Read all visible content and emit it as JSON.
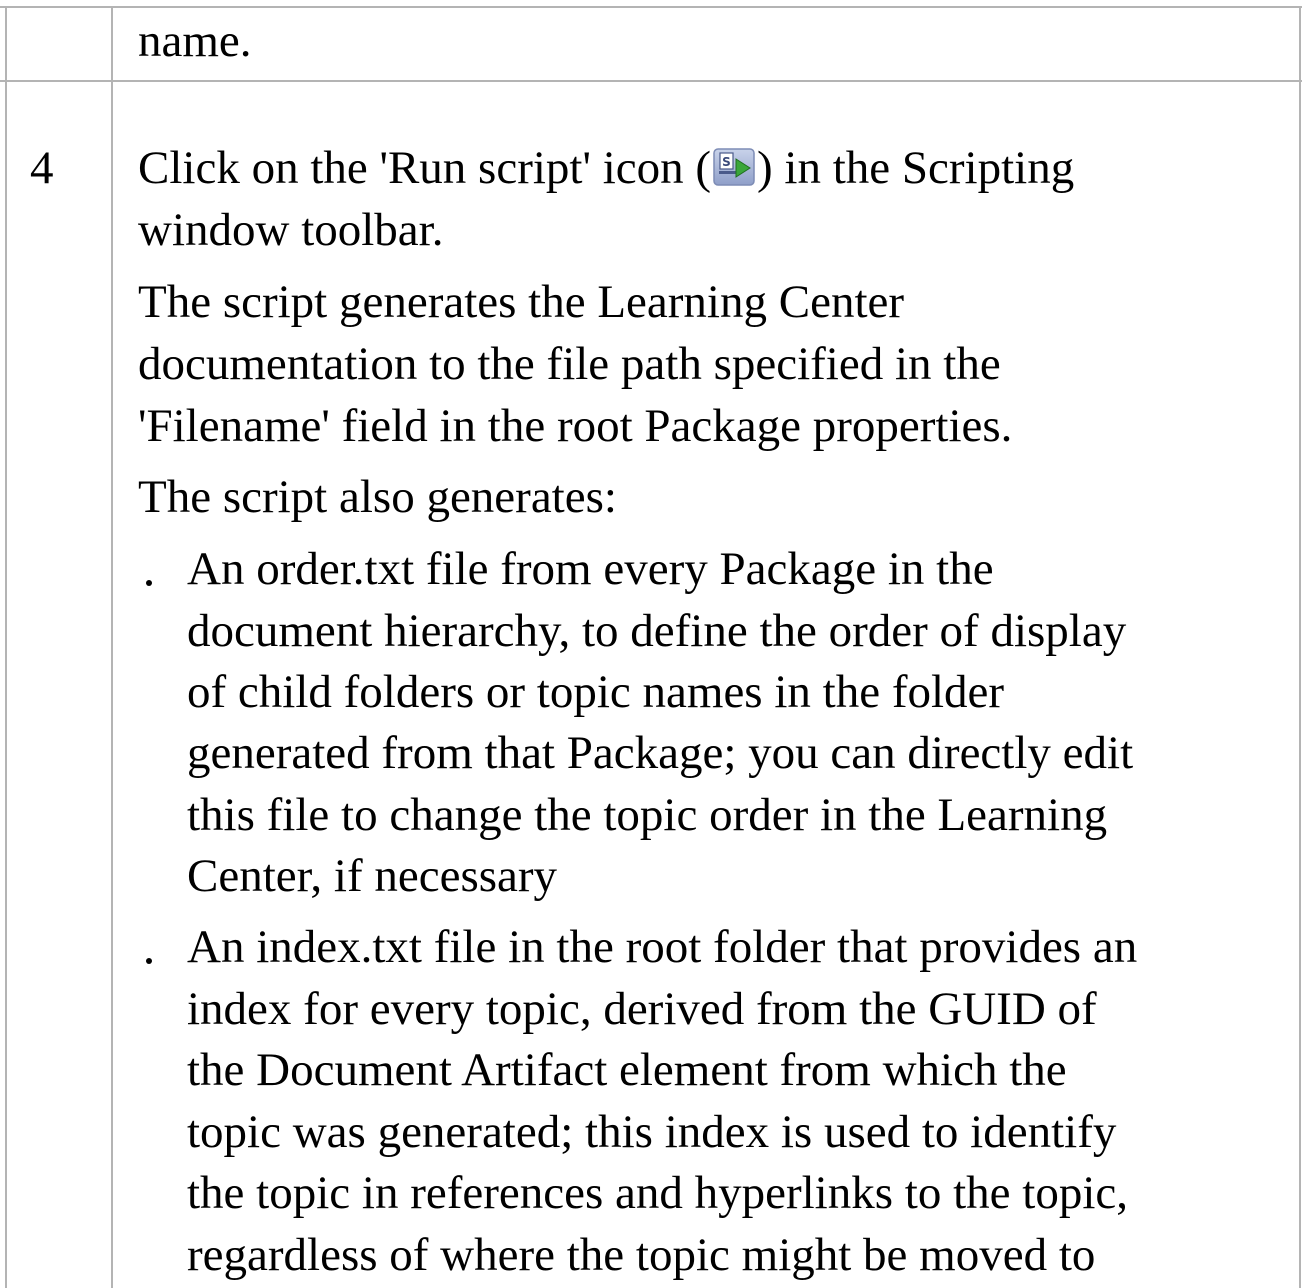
{
  "table": {
    "prev_row": {
      "cell_text": "name."
    },
    "row": {
      "number": "4",
      "intro_before_icon": "Click on the 'Run script' icon (",
      "run_script_icon": "run-script-icon",
      "intro_after_icon": ") in the Scripting",
      "intro_line2": "window toolbar.",
      "para1_lines": [
        "The script generates the Learning Center",
        "documentation to the file path specified in the",
        "'Filename' field in the root Package properties."
      ],
      "para2": "The script also generates:",
      "bullets": [
        {
          "lines": [
            "An order.txt file from every Package in the",
            "document hierarchy, to define the order of display",
            "of child folders or topic names in the folder",
            "generated from that Package; you can directly edit",
            "this file to change the topic order in the Learning",
            "Center, if necessary"
          ]
        },
        {
          "lines": [
            "An index.txt file in the root folder that provides an",
            "index for every topic, derived from the GUID of",
            "the Document Artifact element from which the",
            "topic was generated; this index is used to identify",
            "the topic in references and hyperlinks to the topic,",
            "regardless of where the topic might be moved to"
          ]
        }
      ]
    }
  }
}
